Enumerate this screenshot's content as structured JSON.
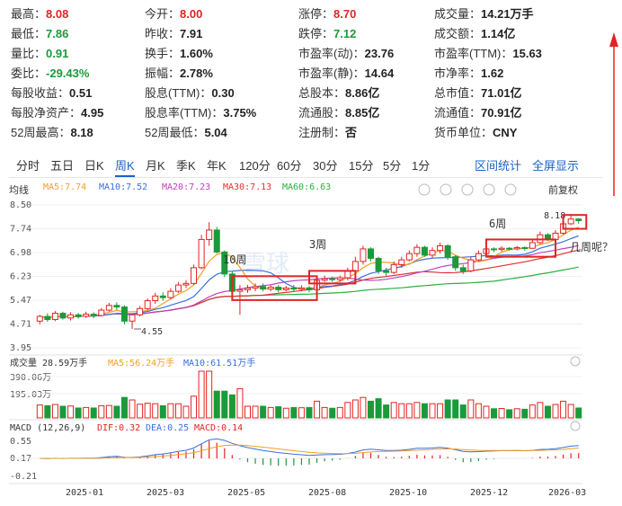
{
  "quote": [
    {
      "label": "最高：",
      "value": "8.08",
      "cls": "up"
    },
    {
      "label": "今开：",
      "value": "8.00",
      "cls": "up"
    },
    {
      "label": "涨停：",
      "value": "8.70",
      "cls": "up"
    },
    {
      "label": "成交量：",
      "value": "14.21万手",
      "cls": ""
    },
    {
      "label": "最低：",
      "value": "7.86",
      "cls": "down"
    },
    {
      "label": "昨收：",
      "value": "7.91",
      "cls": ""
    },
    {
      "label": "跌停：",
      "value": "7.12",
      "cls": "down"
    },
    {
      "label": "成交额：",
      "value": "1.14亿",
      "cls": ""
    },
    {
      "label": "量比：",
      "value": "0.91",
      "cls": "down"
    },
    {
      "label": "换手：",
      "value": "1.60%",
      "cls": ""
    },
    {
      "label": "市盈率(动)：",
      "value": "23.76",
      "cls": ""
    },
    {
      "label": "市盈率(TTM)：",
      "value": "15.63",
      "cls": ""
    },
    {
      "label": "委比：",
      "value": "-29.43%",
      "cls": "down"
    },
    {
      "label": "振幅：",
      "value": "2.78%",
      "cls": ""
    },
    {
      "label": "市盈率(静)：",
      "value": "14.64",
      "cls": ""
    },
    {
      "label": "市净率：",
      "value": "1.62",
      "cls": ""
    },
    {
      "label": "每股收益：",
      "value": "0.51",
      "cls": ""
    },
    {
      "label": "股息(TTM)：",
      "value": "0.30",
      "cls": ""
    },
    {
      "label": "总股本：",
      "value": "8.86亿",
      "cls": ""
    },
    {
      "label": "总市值：",
      "value": "71.01亿",
      "cls": ""
    },
    {
      "label": "每股净资产：",
      "value": "4.95",
      "cls": ""
    },
    {
      "label": "股息率(TTM)：",
      "value": "3.75%",
      "cls": ""
    },
    {
      "label": "流通股：",
      "value": "8.85亿",
      "cls": ""
    },
    {
      "label": "流通值：",
      "value": "70.91亿",
      "cls": ""
    },
    {
      "label": "52周最高：",
      "value": "8.18",
      "cls": ""
    },
    {
      "label": "52周最低：",
      "value": "5.04",
      "cls": ""
    },
    {
      "label": "注册制：",
      "value": "否",
      "cls": ""
    },
    {
      "label": "货币单位：",
      "value": "CNY",
      "cls": ""
    }
  ],
  "tabs": [
    "分时",
    "五日",
    "日K",
    "周K",
    "月K",
    "季K",
    "年K",
    "120分",
    "60分",
    "30分",
    "15分",
    "5分",
    "1分"
  ],
  "active_tab": "周K",
  "tab_links": [
    "区间统计",
    "全屏显示"
  ],
  "ma_legend": [
    {
      "label": "均线",
      "color": "#333333"
    },
    {
      "label": "MA5:7.74",
      "color": "#f0a020"
    },
    {
      "label": "MA10:7.52",
      "color": "#3a6fd8"
    },
    {
      "label": "MA20:7.23",
      "color": "#c040c0"
    },
    {
      "label": "MA30:7.13",
      "color": "#e03030"
    },
    {
      "label": "MA60:6.63",
      "color": "#2ab040"
    }
  ],
  "adjust_label": "前复权",
  "colors": {
    "up": "#e02424",
    "down": "#1a9a3a",
    "ma5": "#f0a020",
    "ma10": "#3a6fd8",
    "ma20": "#c040c0",
    "ma30": "#e03030",
    "ma60": "#2ab040",
    "annot": "#e02424",
    "dif": "#3a6fd8",
    "dea": "#f0a020"
  },
  "chart_data": {
    "type": "candlestick",
    "price_ticks": [
      "8.50",
      "7.74",
      "6.98",
      "6.23",
      "5.47",
      "4.71",
      "3.95"
    ],
    "price_range": [
      3.95,
      8.5
    ],
    "x_ticks": [
      "2025-01",
      "2025-03",
      "2025-05",
      "2025-08",
      "2025-10",
      "2025-12",
      "2026-03"
    ],
    "high_label": "8.18",
    "low_label": "4.55",
    "annotations": [
      "10周",
      "3周",
      "6周",
      "几周呢？"
    ],
    "candles": [
      [
        4.8,
        4.95,
        4.7,
        5.0
      ],
      [
        4.95,
        4.85,
        4.78,
        5.05
      ],
      [
        4.85,
        5.05,
        4.8,
        5.12
      ],
      [
        5.05,
        4.9,
        4.85,
        5.1
      ],
      [
        4.9,
        5.0,
        4.82,
        5.08
      ],
      [
        5.0,
        4.95,
        4.88,
        5.06
      ],
      [
        4.95,
        5.02,
        4.9,
        5.1
      ],
      [
        5.02,
        4.98,
        4.9,
        5.08
      ],
      [
        4.98,
        5.15,
        4.95,
        5.22
      ],
      [
        5.15,
        5.3,
        5.1,
        5.38
      ],
      [
        5.3,
        5.25,
        5.15,
        5.4
      ],
      [
        5.25,
        4.8,
        4.7,
        5.3
      ],
      [
        4.8,
        5.0,
        4.55,
        5.05
      ],
      [
        5.0,
        5.2,
        4.95,
        5.28
      ],
      [
        5.2,
        5.45,
        5.15,
        5.52
      ],
      [
        5.45,
        5.6,
        5.35,
        5.7
      ],
      [
        5.6,
        5.55,
        5.45,
        5.72
      ],
      [
        5.55,
        5.75,
        5.5,
        5.85
      ],
      [
        5.75,
        5.95,
        5.7,
        6.05
      ],
      [
        5.95,
        6.0,
        5.85,
        6.1
      ],
      [
        6.0,
        6.5,
        5.95,
        6.6
      ],
      [
        6.5,
        7.4,
        6.45,
        7.55
      ],
      [
        7.4,
        7.7,
        7.2,
        7.95
      ],
      [
        7.7,
        7.0,
        6.95,
        7.8
      ],
      [
        7.0,
        6.3,
        6.2,
        7.05
      ],
      [
        6.3,
        5.75,
        5.7,
        6.4
      ],
      [
        5.75,
        5.8,
        5.0,
        5.95
      ],
      [
        5.8,
        5.85,
        5.7,
        5.95
      ],
      [
        5.85,
        5.9,
        5.75,
        6.0
      ],
      [
        5.9,
        5.82,
        5.75,
        6.0
      ],
      [
        5.82,
        5.88,
        5.75,
        5.95
      ],
      [
        5.88,
        5.8,
        5.72,
        5.95
      ],
      [
        5.8,
        5.85,
        5.75,
        5.92
      ],
      [
        5.85,
        5.82,
        5.75,
        5.95
      ],
      [
        5.82,
        5.86,
        5.75,
        5.94
      ],
      [
        5.86,
        5.8,
        5.72,
        5.92
      ],
      [
        5.8,
        6.1,
        5.75,
        6.2
      ],
      [
        6.1,
        6.15,
        6.05,
        6.25
      ],
      [
        6.15,
        6.12,
        6.05,
        6.22
      ],
      [
        6.12,
        6.18,
        6.05,
        6.25
      ],
      [
        6.18,
        6.4,
        6.1,
        6.5
      ],
      [
        6.4,
        6.7,
        6.35,
        6.85
      ],
      [
        6.7,
        7.1,
        6.6,
        7.2
      ],
      [
        7.1,
        6.8,
        6.7,
        7.15
      ],
      [
        6.8,
        6.4,
        6.3,
        6.85
      ],
      [
        6.4,
        6.35,
        6.2,
        6.5
      ],
      [
        6.35,
        6.6,
        6.3,
        6.7
      ],
      [
        6.6,
        6.75,
        6.5,
        6.85
      ],
      [
        6.75,
        6.95,
        6.7,
        7.05
      ],
      [
        6.95,
        7.15,
        6.85,
        7.25
      ],
      [
        7.15,
        6.9,
        6.85,
        7.2
      ],
      [
        6.9,
        7.05,
        6.8,
        7.15
      ],
      [
        7.05,
        7.2,
        6.95,
        7.3
      ],
      [
        7.2,
        6.85,
        6.75,
        7.25
      ],
      [
        6.85,
        6.5,
        6.4,
        6.9
      ],
      [
        6.5,
        6.4,
        6.3,
        6.6
      ],
      [
        6.4,
        6.75,
        6.35,
        6.85
      ],
      [
        6.75,
        6.95,
        6.7,
        7.05
      ],
      [
        6.95,
        7.1,
        6.9,
        7.15
      ],
      [
        7.1,
        7.08,
        7.0,
        7.15
      ],
      [
        7.08,
        7.12,
        7.02,
        7.18
      ],
      [
        7.12,
        7.1,
        7.05,
        7.16
      ],
      [
        7.1,
        7.14,
        7.05,
        7.2
      ],
      [
        7.14,
        7.12,
        7.05,
        7.18
      ],
      [
        7.12,
        7.3,
        7.1,
        7.4
      ],
      [
        7.3,
        7.55,
        7.25,
        7.65
      ],
      [
        7.55,
        7.4,
        7.35,
        7.6
      ],
      [
        7.4,
        7.6,
        7.38,
        7.7
      ],
      [
        7.6,
        7.9,
        7.55,
        8.0
      ],
      [
        7.9,
        8.05,
        7.86,
        8.18
      ],
      [
        8.05,
        8.0,
        7.9,
        8.08
      ]
    ],
    "volume_ticks": [
      "390.06万",
      "195.03万"
    ],
    "volume_legend": [
      "成交量 28.59万手",
      "MA5:56.24万手",
      "MA10:61.51万手"
    ],
    "macd_legend": [
      "MACD (12,26,9)",
      "DIF:0.32",
      "DEA:0.25",
      "MACD:0.14"
    ],
    "macd_ticks": [
      "0.55",
      "0.17",
      "-0.21"
    ]
  }
}
